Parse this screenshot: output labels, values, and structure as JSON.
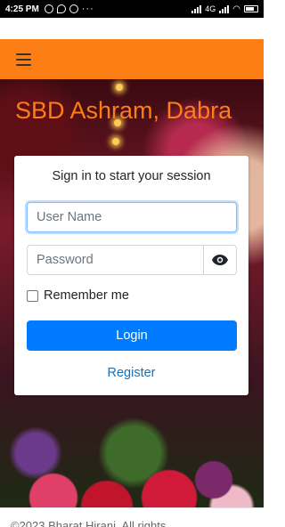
{
  "status_bar": {
    "time": "4:25 PM",
    "dots": "···",
    "network": "4G",
    "battery_label": "battery-icon"
  },
  "navbar": {
    "menu_icon": "hamburger-icon",
    "accent_color": "#fd7e14"
  },
  "site": {
    "title": "SBD Ashram, Dabra"
  },
  "login": {
    "heading": "Sign in to start your session",
    "username_placeholder": "User Name",
    "password_placeholder": "Password",
    "show_password_icon": "eye-icon",
    "remember_label": "Remember me",
    "remember_checked": false,
    "login_button": "Login",
    "register_link": "Register",
    "primary_color": "#007bff"
  },
  "footer": {
    "text": "©2023 Bharat Hirani. All rights"
  }
}
